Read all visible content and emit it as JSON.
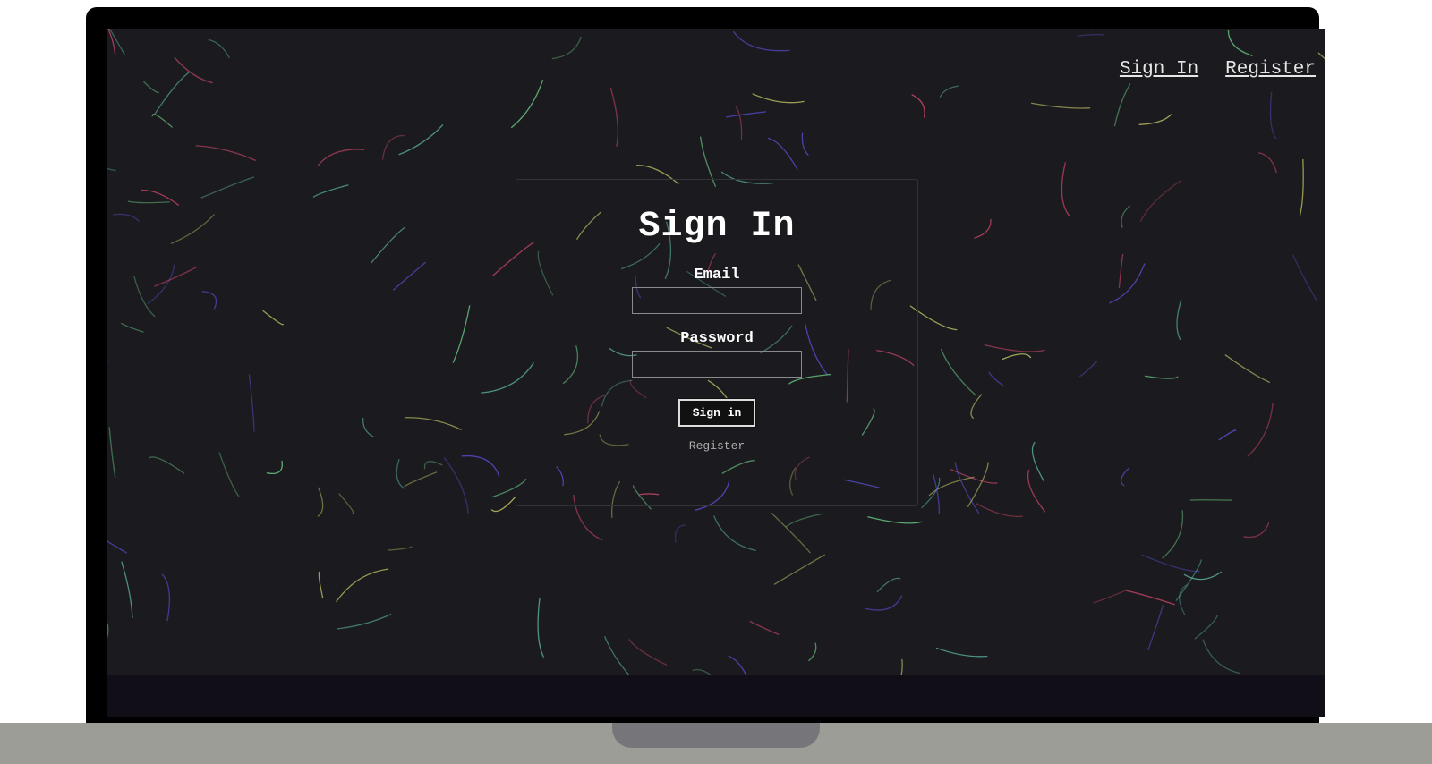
{
  "nav": {
    "sign_in": "Sign In",
    "register": "Register"
  },
  "form": {
    "title": "Sign In",
    "email_label": "Email",
    "email_value": "",
    "password_label": "Password",
    "password_value": "",
    "submit_label": "Sign in",
    "register_link": "Register"
  },
  "colors": {
    "background": "#1b1b1f",
    "strands": [
      "#6fd18a",
      "#d2476b",
      "#5a4fd6",
      "#c9c96a",
      "#5fb8a8"
    ]
  }
}
